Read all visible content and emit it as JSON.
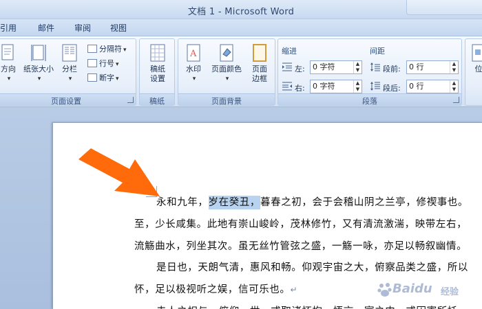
{
  "window": {
    "title": "文档 1 - Microsoft Word"
  },
  "tabs": [
    "引用",
    "邮件",
    "审阅",
    "视图"
  ],
  "ribbon": {
    "page_setup": {
      "label": "页面设置",
      "buttons": {
        "orientation": "方向",
        "size": "纸张大小",
        "columns": "分栏"
      },
      "small": {
        "breaks": "分隔符",
        "line_numbers": "行号",
        "hyphenation": "断字"
      }
    },
    "manuscript": {
      "label": "稿纸",
      "button_line1": "稿纸",
      "button_line2": "设置"
    },
    "page_background": {
      "label": "页面背景",
      "watermark": "水印",
      "page_color": "页面颜色",
      "page_borders_line1": "页面",
      "page_borders_line2": "边框"
    },
    "paragraph": {
      "label": "段落",
      "indent_header": "缩进",
      "spacing_header": "间距",
      "left_label": "左:",
      "right_label": "右:",
      "before_label": "段前:",
      "after_label": "段后:",
      "left_value": "0 字符",
      "right_value": "0 字符",
      "before_value": "0 行",
      "after_value": "0 行"
    },
    "arrange": {
      "position_partial": "位"
    }
  },
  "document": {
    "line1_before": "永和九年，",
    "line1_selected": "岁在癸丑，",
    "line1_after": "暮春之初，会于会稽山阴之兰亭，修禊事也。",
    "line2": "至，少长咸集。此地有崇山峻岭，茂林修竹，又有清流激湍，映带左右，",
    "line3": "流觞曲水，列坐其次。虽无丝竹管弦之盛，一觞一咏，亦足以畅叙幽情。",
    "line4": "是日也，天朗气清，惠风和畅。仰观宇宙之大，俯察品类之盛，所以",
    "line5": "怀，足以极视听之娱，信可乐也。",
    "para_mark": "↵",
    "line6": "夫人之相与，俯仰一世，或取诸怀抱，悟言一室之内，或因寄所托，"
  },
  "watermark": {
    "brand": "Baidu",
    "sub": "经验"
  },
  "colors": {
    "arrow": "#ff6a0a",
    "selection": "#b8d3ef",
    "ribbon_text": "#1d3150"
  }
}
